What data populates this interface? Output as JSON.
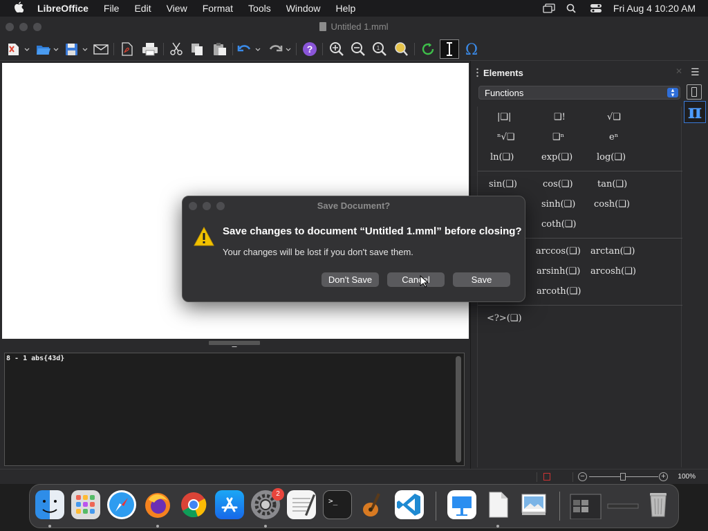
{
  "menubar": {
    "app_name": "LibreOffice",
    "items": [
      "File",
      "Edit",
      "View",
      "Format",
      "Tools",
      "Window",
      "Help"
    ],
    "clock": "Fri Aug 4  10:20 AM"
  },
  "window": {
    "title": "Untitled 1.mml"
  },
  "command": {
    "text": "8 - 1 abs{43d}"
  },
  "sidebar": {
    "title": "Elements",
    "category": "Functions",
    "deck_icon": "π",
    "palette": [
      [
        "|❑|",
        "❑!",
        "√❑"
      ],
      [
        "ⁿ√❑",
        "❑ⁿ",
        "eⁿ"
      ],
      [
        "ln(❑)",
        "exp(❑)",
        "log(❑)"
      ],
      [
        "sin(❑)",
        "cos(❑)",
        "tan(❑)"
      ],
      [
        "sinh(❑)",
        "cosh(❑)"
      ],
      [
        "coth(❑)"
      ],
      [
        "arccos(❑)",
        "arctan(❑)"
      ],
      [
        "arsinh(❑)",
        "arcosh(❑)"
      ],
      [
        "arcoth(❑)"
      ],
      [
        "<?>(❑)"
      ]
    ]
  },
  "statusbar": {
    "zoom": "100%"
  },
  "dialog": {
    "title": "Save Document?",
    "heading": "Save changes to document “Untitled 1.mml” before closing?",
    "message": "Your changes will be lost if you don't save them.",
    "buttons": {
      "dont_save": "Don't Save",
      "cancel": "Cancel",
      "save": "Save"
    }
  },
  "dock": {
    "badge_count": "2",
    "apps": [
      "finder-icon",
      "launchpad-icon",
      "safari-icon",
      "firefox-icon",
      "chrome-icon",
      "app-store-icon",
      "system-settings-icon",
      "textedit-icon",
      "terminal-icon",
      "garageband-icon",
      "vscode-icon",
      "keynote-icon",
      "libreoffice-icon",
      "preview-icon",
      "recent-windows-icon",
      "trash-icon"
    ]
  },
  "colors": {
    "accent": "#2f6ed8",
    "pi_icon": "#4d9cff",
    "badge": "#e8453c"
  }
}
